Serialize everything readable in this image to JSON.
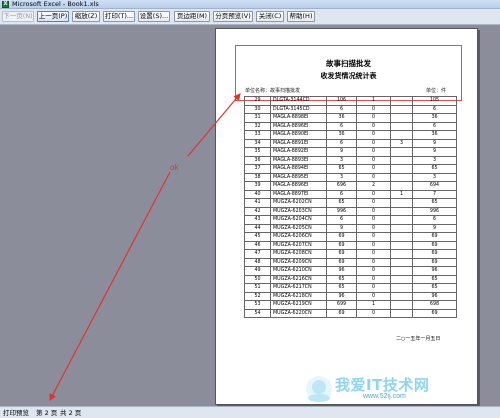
{
  "window": {
    "title": "Microsoft Excel - Book1.xls"
  },
  "toolbar": {
    "buttons": [
      {
        "label": "下一页(N)",
        "state": "disabled"
      },
      {
        "label": "上一页(P)",
        "state": "focused"
      },
      {
        "label": "缩放(Z)",
        "state": "normal"
      },
      {
        "label": "打印(T)...",
        "state": "normal"
      },
      {
        "label": "设置(S)...",
        "state": "normal"
      },
      {
        "label": "页边距(M)",
        "state": "normal"
      },
      {
        "label": "分页预览(V)",
        "state": "normal"
      },
      {
        "label": "关闭(C)",
        "state": "normal"
      },
      {
        "label": "帮助(H)",
        "state": "normal"
      }
    ]
  },
  "sheet": {
    "header_title": "故事扫描批发",
    "header_subtitle": "收发货情况统计表",
    "unit_name": "单位名称：故事扫描批发",
    "unit_label": "单位：件",
    "rows": [
      [
        "29",
        "DLGTA-3144CD",
        "106",
        "1",
        "",
        "105"
      ],
      [
        "30",
        "DLGTA-3145CD",
        "6",
        "0",
        "",
        "6"
      ],
      [
        "31",
        "MAGLA-8898EI",
        "36",
        "0",
        "",
        "36"
      ],
      [
        "32",
        "MAGLA-8896EI",
        "6",
        "0",
        "",
        "6"
      ],
      [
        "33",
        "MAGLA-8890EI",
        "36",
        "0",
        "",
        "36"
      ],
      [
        "34",
        "MAGLA-8891EI",
        "6",
        "0",
        "3",
        "9"
      ],
      [
        "35",
        "MAGLA-8892EI",
        "9",
        "0",
        "",
        "9"
      ],
      [
        "36",
        "MAGLA-8893EI",
        "3",
        "0",
        "",
        "3"
      ],
      [
        "37",
        "MAGLA-8894EI",
        "65",
        "0",
        "",
        "65"
      ],
      [
        "38",
        "MAGLA-8895EI",
        "3",
        "0",
        "",
        "3"
      ],
      [
        "39",
        "MAGLA-8896EI",
        "696",
        "2",
        "",
        "694"
      ],
      [
        "40",
        "MAGLA-8897EI",
        "6",
        "0",
        "1",
        "7"
      ],
      [
        "41",
        "MUGZA-6202CN",
        "65",
        "0",
        "",
        "65"
      ],
      [
        "42",
        "MUGZA-6203CN",
        "996",
        "0",
        "",
        "996"
      ],
      [
        "43",
        "MUGZA-6204CN",
        "6",
        "0",
        "",
        "6"
      ],
      [
        "44",
        "MUGZA-6205CN",
        "9",
        "0",
        "",
        "9"
      ],
      [
        "45",
        "MUGZA-6206CN",
        "69",
        "0",
        "",
        "69"
      ],
      [
        "46",
        "MUGZA-6207CN",
        "69",
        "0",
        "",
        "69"
      ],
      [
        "47",
        "MUGZA-6208CN",
        "69",
        "0",
        "",
        "69"
      ],
      [
        "48",
        "MUGZA-6209CN",
        "69",
        "0",
        "",
        "69"
      ],
      [
        "49",
        "MUGZA-6210CN",
        "96",
        "0",
        "",
        "96"
      ],
      [
        "50",
        "MUGZA-6216CN",
        "65",
        "0",
        "",
        "65"
      ],
      [
        "51",
        "MUGZA-6217CN",
        "65",
        "0",
        "",
        "65"
      ],
      [
        "52",
        "MUGZA-6218CN",
        "96",
        "0",
        "",
        "96"
      ],
      [
        "53",
        "MUGZA-6219CN",
        "699",
        "1",
        "",
        "698"
      ],
      [
        "54",
        "MUGZA-6220CN",
        "69",
        "0",
        "",
        "69"
      ]
    ],
    "footer_date": "二○一五年一月五日"
  },
  "annotation": {
    "text": "ok",
    "color": "#e0342a"
  },
  "watermark": {
    "text": "我爱IT技术网",
    "domain": "www.52ij.com"
  },
  "statusbar": {
    "mode": "打印预览",
    "page_info": "第 2 页",
    "total_pages": "共 2 页"
  }
}
